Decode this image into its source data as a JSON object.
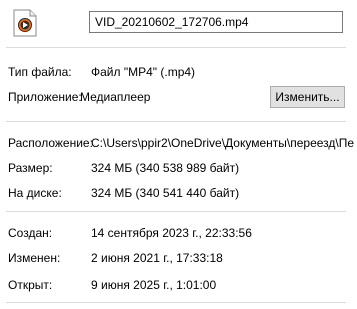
{
  "header": {
    "icon": "media-file-icon",
    "file_name": "VID_20210602_172706.mp4"
  },
  "type_section": {
    "type_label": "Тип файла:",
    "type_value": "Файл \"MP4\" (.mp4)",
    "app_label": "Приложение:",
    "app_value": "Медиаплеер",
    "app_icon": "media-player-icon",
    "change_button": "Изменить..."
  },
  "location_section": {
    "location_label": "Расположение:",
    "location_value": "C:\\Users\\ppir2\\OneDrive\\Документы\\переезд\\Пе",
    "size_label": "Размер:",
    "size_value": "324 МБ (340 538 989 байт)",
    "disk_label": "На диске:",
    "disk_value": "324 МБ (340 541 440 байт)"
  },
  "dates_section": {
    "created_label": "Создан:",
    "created_value": "14 сентября 2023 г., 22:33:56",
    "modified_label": "Изменен:",
    "modified_value": "2 июня 2021 г., 17:33:18",
    "opened_label": "Открыт:",
    "opened_value": "9 июня 2025 г., 1:01:00"
  },
  "colors": {
    "divider": "#dcdcdc",
    "button_bg": "#e1e1e1",
    "icon_dark": "#2b2b2b",
    "icon_accent": "#ff6a00"
  }
}
